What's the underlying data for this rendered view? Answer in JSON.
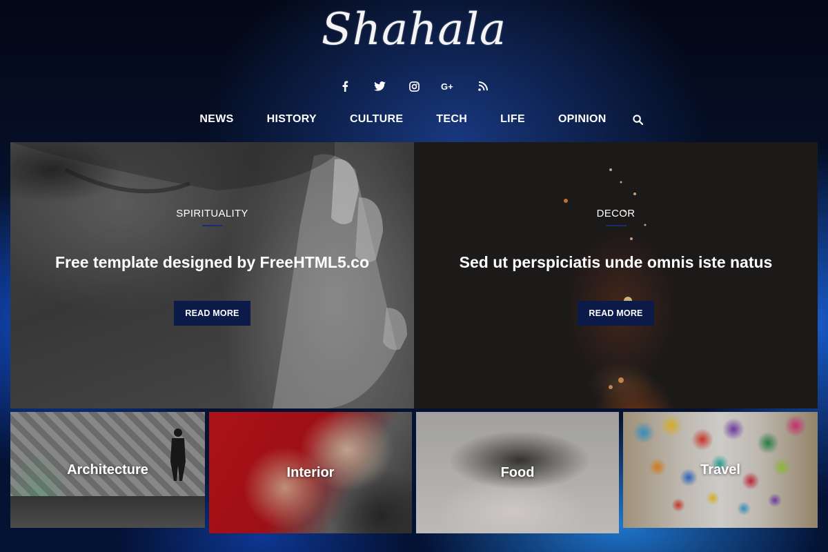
{
  "site": {
    "logo": "Shahala"
  },
  "social": [
    {
      "icon": "facebook-icon",
      "glyph": "f"
    },
    {
      "icon": "twitter-icon",
      "glyph": "t"
    },
    {
      "icon": "instagram-icon",
      "glyph": "ig"
    },
    {
      "icon": "google-plus-icon",
      "glyph": "G+"
    },
    {
      "icon": "rss-icon",
      "glyph": "rss"
    }
  ],
  "nav": {
    "items": [
      "NEWS",
      "HISTORY",
      "CULTURE",
      "TECH",
      "LIFE",
      "OPINION"
    ],
    "search_icon": "search-icon"
  },
  "hero": [
    {
      "category": "SPIRITUALITY",
      "title": "Free template designed by FreeHTML5.co",
      "button": "READ MORE"
    },
    {
      "category": "DECOR",
      "title": "Sed ut perspiciatis unde omnis iste natus",
      "button": "READ MORE"
    }
  ],
  "categories": [
    "Architecture",
    "Interior",
    "Food",
    "Travel"
  ],
  "colors": {
    "button_bg": "#0c1a4a",
    "accent_rule": "#1b2d6e",
    "header_bg": "#04091a",
    "glow": "#1f6fe6"
  }
}
